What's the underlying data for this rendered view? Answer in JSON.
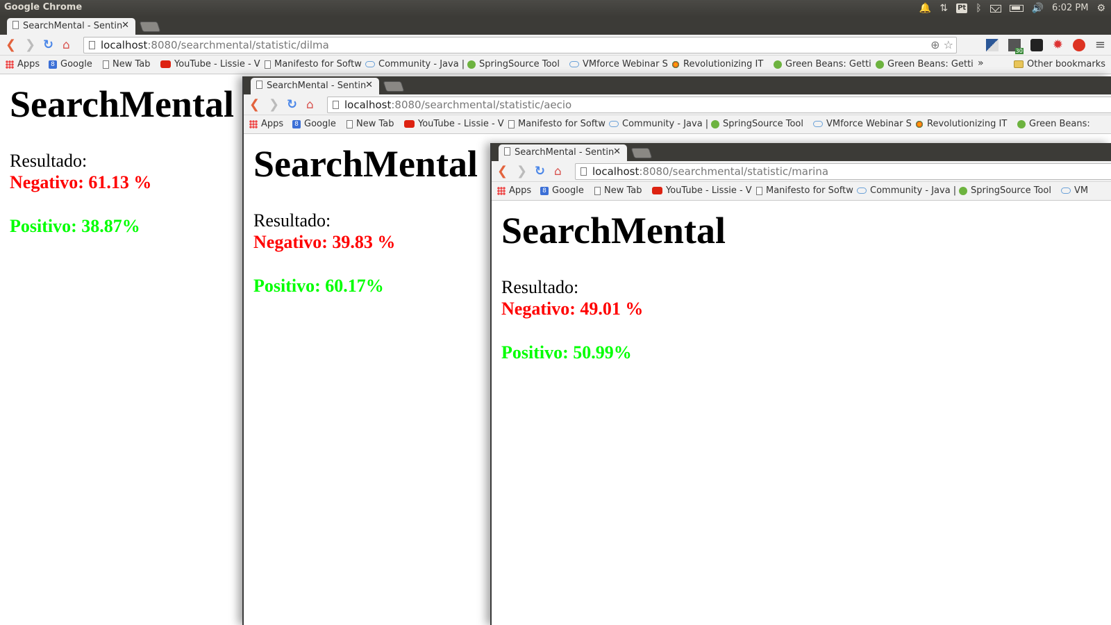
{
  "os": {
    "app_title": "Google Chrome",
    "time": "6:02 PM",
    "pt_label": "Pt"
  },
  "bookmarks": {
    "apps": "Apps",
    "google": "Google",
    "new_tab": "New Tab",
    "youtube": "YouTube - Lissie - V",
    "manifesto": "Manifesto for Softw",
    "community": "Community - Java |",
    "springsource": "SpringSource Tool",
    "vmforce": "VMforce Webinar S",
    "revolutionizing": "Revolutionizing IT",
    "green_beans_1": "Green Beans: Getti",
    "green_beans_2": "Green Beans: Getti",
    "green_beans_short": "Green Beans:",
    "vm_short": "VM",
    "more": "»",
    "other": "Other bookmarks"
  },
  "ext_badge": "30",
  "windows": [
    {
      "tab_title": "SearchMental - Sentin",
      "url_host": "localhost",
      "url_path": ":8080/searchmental/statistic/dilma",
      "heading": "SearchMental",
      "result_label": "Resultado:",
      "negative": "Negativo: 61.13 %",
      "positive": "Positivo: 38.87%"
    },
    {
      "tab_title": "SearchMental - Sentin",
      "url_host": "localhost",
      "url_path": ":8080/searchmental/statistic/aecio",
      "heading": "SearchMental",
      "result_label": "Resultado:",
      "negative": "Negativo: 39.83 %",
      "positive": "Positivo: 60.17%"
    },
    {
      "tab_title": "SearchMental - Sentin",
      "url_host": "localhost",
      "url_path": ":8080/searchmental/statistic/marina",
      "heading": "SearchMental",
      "result_label": "Resultado:",
      "negative": "Negativo: 49.01 %",
      "positive": "Positivo: 50.99%"
    }
  ]
}
